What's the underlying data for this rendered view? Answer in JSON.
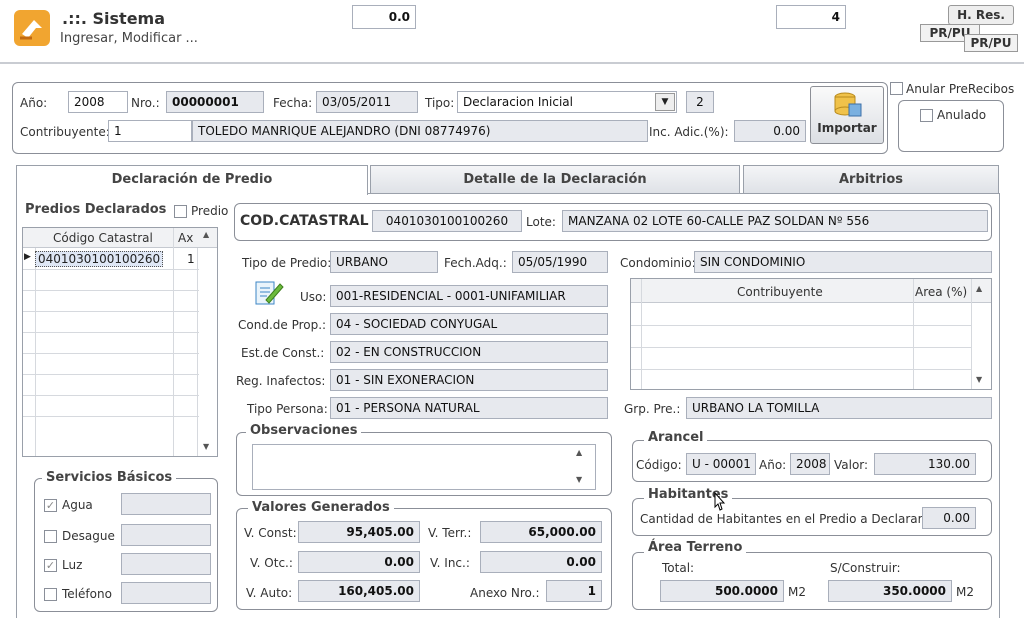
{
  "app": {
    "title": ".::. Sistema",
    "subtitle": "Ingresar, Modificar ..."
  },
  "top": {
    "value_a": "0.0",
    "value_b": "4",
    "btn_hres": "H. Res.",
    "btn_prpu": "PR/PU",
    "btn_prpu2": "PR/PU"
  },
  "header": {
    "anio_label": "Año:",
    "anio": "2008",
    "nro_label": "Nro.:",
    "nro": "00000001",
    "fecha_label": "Fecha:",
    "fecha": "03/05/2011",
    "tipo_label": "Tipo:",
    "tipo": "Declaracion Inicial",
    "tipo_num": "2",
    "contrib_label": "Contribuyente:",
    "contrib_id": "1",
    "contrib_name": "TOLEDO MANRIQUE ALEJANDRO (DNI 08774976)",
    "inc_label": "Inc. Adic.(%):",
    "inc": "0.00",
    "importar": "Importar",
    "anular_prerecibos": "Anular PreRecibos",
    "anulado": "Anulado"
  },
  "tabs": [
    "Declaración de Predio",
    "Detalle de la Declaración",
    "Arbitrios"
  ],
  "predios": {
    "title": "Predios Declarados",
    "chk_label": "Predio",
    "col1": "Código Catastral",
    "col2": "Ax",
    "rows": [
      {
        "code": "0401030100100260",
        "ax": "1"
      }
    ]
  },
  "servicios": {
    "title": "Servicios Básicos",
    "items": [
      {
        "label": "Agua",
        "checked": true
      },
      {
        "label": "Desague",
        "checked": false
      },
      {
        "label": "Luz",
        "checked": true
      },
      {
        "label": "Teléfono",
        "checked": false
      }
    ]
  },
  "catastral": {
    "label": "COD.CATASTRAL",
    "value": "0401030100100260",
    "lote_label": "Lote:",
    "lote": "MANZANA 02 LOTE 60-CALLE PAZ SOLDAN  Nº 556"
  },
  "predio": {
    "tipo_label": "Tipo de Predio:",
    "tipo": "URBANO",
    "fech_label": "Fech.Adq.:",
    "fech": "05/05/1990",
    "uso_label": "Uso:",
    "uso": "001-RESIDENCIAL - 0001-UNIFAMILIAR",
    "cond_label": "Cond.de Prop.:",
    "cond": "04 - SOCIEDAD CONYUGAL",
    "est_label": "Est.de Const.:",
    "est": "02 - EN CONSTRUCCION",
    "reg_label": "Reg. Inafectos:",
    "reg": "01 - SIN EXONERACION",
    "tp_label": "Tipo Persona:",
    "tp": "01 - PERSONA NATURAL",
    "condominio_label": "Condominio:",
    "condominio": "SIN CONDOMINIO",
    "grp_label": "Grp. Pre.:",
    "grp": "URBANO LA TOMILLA"
  },
  "contrib_grid": {
    "col1": "Contribuyente",
    "col2": "Area (%)"
  },
  "observaciones": {
    "title": "Observaciones"
  },
  "valores": {
    "title": "Valores Generados",
    "vconst_label": "V. Const:",
    "vconst": "95,405.00",
    "vterr_label": "V. Terr.:",
    "vterr": "65,000.00",
    "votc_label": "V. Otc.:",
    "votc": "0.00",
    "vinc_label": "V. Inc.:",
    "vinc": "0.00",
    "vauto_label": "V. Auto:",
    "vauto": "160,405.00",
    "anexo_label": "Anexo Nro.:",
    "anexo": "1"
  },
  "arancel": {
    "title": "Arancel",
    "codigo_label": "Código:",
    "codigo": "U - 00001",
    "anio_label": "Año:",
    "anio": "2008",
    "valor_label": "Valor:",
    "valor": "130.00"
  },
  "habitantes": {
    "title": "Habitantes",
    "label": "Cantidad de Habitantes en el Predio a Declarar:",
    "value": "0.00"
  },
  "area": {
    "title": "Área Terreno",
    "total_label": "Total:",
    "total": "500.0000",
    "total_unit": "M2",
    "sc_label": "S/Construir:",
    "sc": "350.0000",
    "sc_unit": "M2"
  }
}
